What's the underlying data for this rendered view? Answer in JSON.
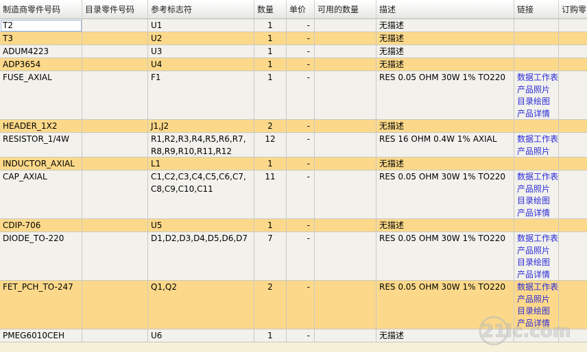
{
  "headers": [
    "制造商零件号码",
    "目录零件号码",
    "参考标志符",
    "数量",
    "单价",
    "可用的数量",
    "描述",
    "链接",
    "订购零"
  ],
  "rows": [
    {
      "mfr": "T2",
      "cat": "",
      "ref": "U1",
      "qty": "1",
      "price": "-",
      "avail": "",
      "desc": "无描述",
      "links": [],
      "style": "norm"
    },
    {
      "mfr": "T3",
      "cat": "",
      "ref": "U2",
      "qty": "1",
      "price": "-",
      "avail": "",
      "desc": "无描述",
      "links": [],
      "style": "alt"
    },
    {
      "mfr": "ADUM4223",
      "cat": "",
      "ref": "U3",
      "qty": "1",
      "price": "-",
      "avail": "",
      "desc": "无描述",
      "links": [],
      "style": "norm"
    },
    {
      "mfr": "ADP3654",
      "cat": "",
      "ref": "U4",
      "qty": "1",
      "price": "-",
      "avail": "",
      "desc": "无描述",
      "links": [],
      "style": "alt"
    },
    {
      "mfr": "FUSE_AXIAL",
      "cat": "",
      "ref": "F1",
      "qty": "1",
      "price": "-",
      "avail": "",
      "desc": "RES 0.05 OHM 30W 1% TO220",
      "links": [
        "数据工作表",
        "产品照片",
        "目录绘图",
        "产品详情"
      ],
      "style": "norm"
    },
    {
      "mfr": "HEADER_1X2",
      "cat": "",
      "ref": "J1,J2",
      "qty": "2",
      "price": "-",
      "avail": "",
      "desc": "无描述",
      "links": [],
      "style": "alt"
    },
    {
      "mfr": "RESISTOR_1/4W",
      "cat": "",
      "ref": "R1,R2,R3,R4,R5,R6,R7,\nR8,R9,R10,R11,R12",
      "qty": "12",
      "price": "-",
      "avail": "",
      "desc": "RES 16 OHM 0.4W 1% AXIAL",
      "links": [
        "数据工作表",
        "产品照片"
      ],
      "style": "norm"
    },
    {
      "mfr": "INDUCTOR_AXIAL",
      "cat": "",
      "ref": "L1",
      "qty": "1",
      "price": "-",
      "avail": "",
      "desc": "无描述",
      "links": [],
      "style": "alt"
    },
    {
      "mfr": "CAP_AXIAL",
      "cat": "",
      "ref": "C1,C2,C3,C4,C5,C6,C7,\nC8,C9,C10,C11",
      "qty": "11",
      "price": "-",
      "avail": "",
      "desc": "RES 0.05 OHM 30W 1% TO220",
      "links": [
        "数据工作表",
        "产品照片",
        "目录绘图",
        "产品详情"
      ],
      "style": "norm"
    },
    {
      "mfr": "CDIP-706",
      "cat": "",
      "ref": "U5",
      "qty": "1",
      "price": "-",
      "avail": "",
      "desc": "无描述",
      "links": [],
      "style": "alt"
    },
    {
      "mfr": "DIODE_TO-220",
      "cat": "",
      "ref": "D1,D2,D3,D4,D5,D6,D7",
      "qty": "7",
      "price": "-",
      "avail": "",
      "desc": "RES 0.05 OHM 30W 1% TO220",
      "links": [
        "数据工作表",
        "产品照片",
        "目录绘图",
        "产品详情"
      ],
      "style": "norm"
    },
    {
      "mfr": "FET_PCH_TO-247",
      "cat": "",
      "ref": "Q1,Q2",
      "qty": "2",
      "price": "-",
      "avail": "",
      "desc": "RES 0.05 OHM 30W 1% TO220",
      "links": [
        "数据工作表",
        "产品照片",
        "目录绘图",
        "产品详情"
      ],
      "style": "alt"
    },
    {
      "mfr": "PMEG6010CEH",
      "cat": "",
      "ref": "U6",
      "qty": "1",
      "price": "-",
      "avail": "",
      "desc": "无描述",
      "links": [],
      "style": "norm"
    }
  ],
  "watermark": "21ic.com",
  "colors": {
    "highlight_row": "#fcd98a",
    "normal_row": "#f2f1ec",
    "link": "#2b2bd8",
    "grid": "#c9c8c2"
  }
}
